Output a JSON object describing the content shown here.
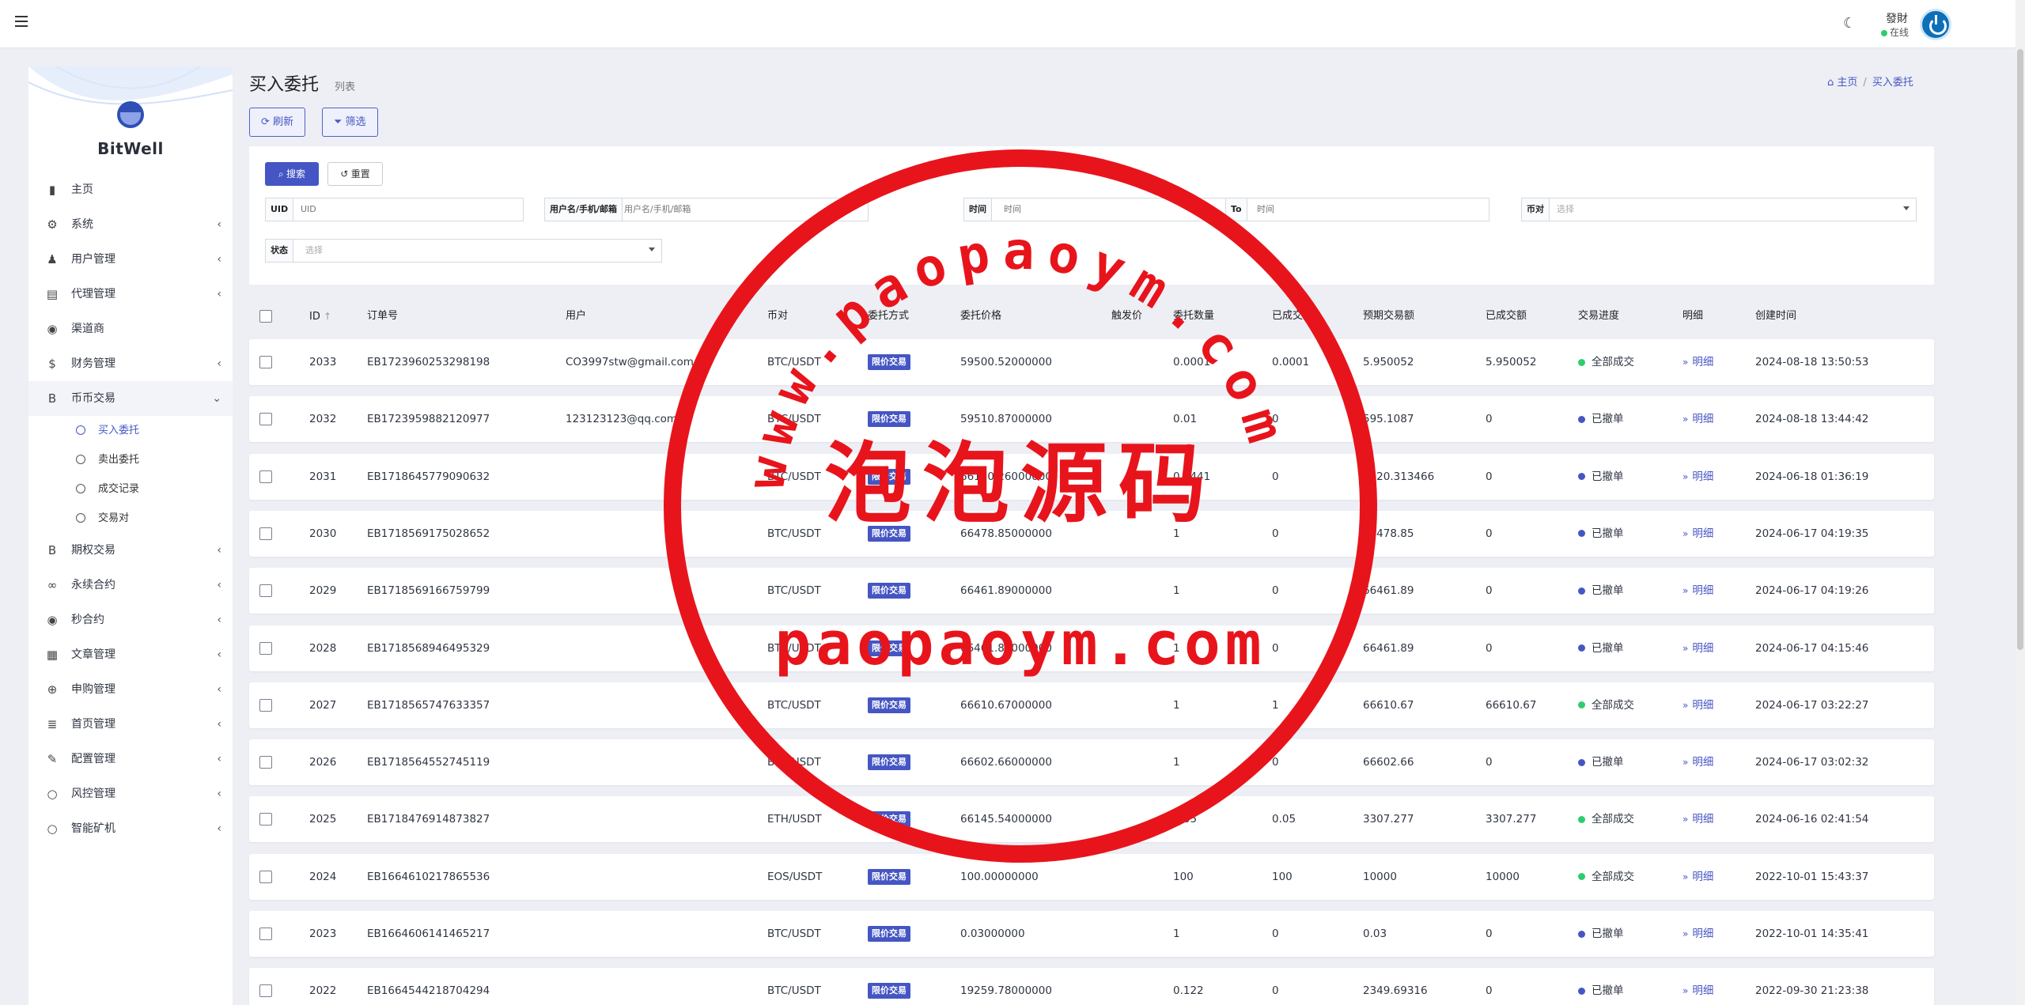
{
  "topbar": {
    "user_name": "發財",
    "user_status": "在线"
  },
  "sidebar": {
    "brand": "BitWell",
    "items": [
      {
        "label": "主页",
        "icon": "bar-chart-icon",
        "chev": false
      },
      {
        "label": "系统",
        "icon": "gear-icon",
        "chev": true
      },
      {
        "label": "用户管理",
        "icon": "users-icon",
        "chev": true
      },
      {
        "label": "代理管理",
        "icon": "id-card-icon",
        "chev": true
      },
      {
        "label": "渠道商",
        "icon": "user-circle-icon",
        "chev": false
      },
      {
        "label": "财务管理",
        "icon": "dollar-icon",
        "chev": true
      },
      {
        "label": "币币交易",
        "icon": "bitcoin-icon",
        "chev": true,
        "open": true
      }
    ],
    "sub_items": [
      {
        "label": "买入委托",
        "active": true
      },
      {
        "label": "卖出委托",
        "active": false
      },
      {
        "label": "成交记录",
        "active": false
      },
      {
        "label": "交易对",
        "active": false
      }
    ],
    "items_after": [
      {
        "label": "期权交易",
        "icon": "bitcoin-icon"
      },
      {
        "label": "永续合约",
        "icon": "link-icon"
      },
      {
        "label": "秒合约",
        "icon": "record-icon"
      },
      {
        "label": "文章管理",
        "icon": "newspaper-icon"
      },
      {
        "label": "申购管理",
        "icon": "life-ring-icon"
      },
      {
        "label": "首页管理",
        "icon": "list-icon"
      },
      {
        "label": "配置管理",
        "icon": "wrench-icon"
      },
      {
        "label": "风控管理",
        "icon": "circle-icon"
      },
      {
        "label": "智能矿机",
        "icon": "circle-icon"
      }
    ]
  },
  "page": {
    "title": "买入委托",
    "subtitle": "列表",
    "breadcrumb_home": "主页",
    "breadcrumb_current": "买入委托",
    "refresh_label": "刷新",
    "filter_label": "筛选"
  },
  "filters": {
    "search_label": "搜索",
    "reset_label": "重置",
    "uid_label": "UID",
    "uid_placeholder": "UID",
    "user_label": "用户名/手机/邮箱",
    "user_placeholder": "用户名/手机/邮箱",
    "time_label": "时间",
    "time_placeholder": "时间",
    "to_label": "To",
    "to_placeholder": "时间",
    "pair_label": "币对",
    "pair_placeholder": "选择",
    "status_label": "状态",
    "status_placeholder": "选择"
  },
  "table": {
    "headers": [
      "ID",
      "订单号",
      "用户",
      "币对",
      "委托方式",
      "委托价格",
      "触发价",
      "委托数量",
      "已成交数",
      "预期交易额",
      "已成交额",
      "交易进度",
      "明细",
      "创建时间"
    ],
    "sort_icon": "↑",
    "rows": [
      {
        "id": "2033",
        "order": "EB1723960253298198",
        "user": "CO3997stw@gmail.com",
        "pair": "BTC/USDT",
        "mode": "限价交易",
        "price": "59500.52000000",
        "trigger": "",
        "qty": "0.0001",
        "done_qty": "0.0001",
        "expected": "5.950052",
        "done_amt": "5.950052",
        "status": "全部成交",
        "status_color": "#2ecc71",
        "detail": "明细",
        "time": "2024-08-18 13:50:53"
      },
      {
        "id": "2032",
        "order": "EB1723959882120977",
        "user": "123123123@qq.com",
        "pair": "BTC/USDT",
        "mode": "限价交易",
        "price": "59510.87000000",
        "trigger": "",
        "qty": "0.01",
        "done_qty": "0",
        "expected": "595.1087",
        "done_amt": "0",
        "status": "已撤单",
        "status_color": "#4556c4",
        "detail": "明细",
        "time": "2024-08-18 13:44:42"
      },
      {
        "id": "2031",
        "order": "EB1718645779090632",
        "user": "",
        "pair": "BTC/USDT",
        "mode": "限价交易",
        "price": "66120.26000000",
        "trigger": "",
        "qty": "0.0441",
        "done_qty": "0",
        "expected": "2920.313466",
        "done_amt": "0",
        "status": "已撤单",
        "status_color": "#4556c4",
        "detail": "明细",
        "time": "2024-06-18 01:36:19"
      },
      {
        "id": "2030",
        "order": "EB1718569175028652",
        "user": "",
        "pair": "BTC/USDT",
        "mode": "限价交易",
        "price": "66478.85000000",
        "trigger": "",
        "qty": "1",
        "done_qty": "0",
        "expected": "66478.85",
        "done_amt": "0",
        "status": "已撤单",
        "status_color": "#4556c4",
        "detail": "明细",
        "time": "2024-06-17 04:19:35"
      },
      {
        "id": "2029",
        "order": "EB1718569166759799",
        "user": "",
        "pair": "BTC/USDT",
        "mode": "限价交易",
        "price": "66461.89000000",
        "trigger": "",
        "qty": "1",
        "done_qty": "0",
        "expected": "66461.89",
        "done_amt": "0",
        "status": "已撤单",
        "status_color": "#4556c4",
        "detail": "明细",
        "time": "2024-06-17 04:19:26"
      },
      {
        "id": "2028",
        "order": "EB1718568946495329",
        "user": "",
        "pair": "BTC/USDT",
        "mode": "限价交易",
        "price": "66461.89000000",
        "trigger": "",
        "qty": "1",
        "done_qty": "0",
        "expected": "66461.89",
        "done_amt": "0",
        "status": "已撤单",
        "status_color": "#4556c4",
        "detail": "明细",
        "time": "2024-06-17 04:15:46"
      },
      {
        "id": "2027",
        "order": "EB1718565747633357",
        "user": "",
        "pair": "BTC/USDT",
        "mode": "限价交易",
        "price": "66610.67000000",
        "trigger": "",
        "qty": "1",
        "done_qty": "1",
        "expected": "66610.67",
        "done_amt": "66610.67",
        "status": "全部成交",
        "status_color": "#2ecc71",
        "detail": "明细",
        "time": "2024-06-17 03:22:27"
      },
      {
        "id": "2026",
        "order": "EB1718564552745119",
        "user": "",
        "pair": "BTC/USDT",
        "mode": "限价交易",
        "price": "66602.66000000",
        "trigger": "",
        "qty": "1",
        "done_qty": "0",
        "expected": "66602.66",
        "done_amt": "0",
        "status": "已撤单",
        "status_color": "#4556c4",
        "detail": "明细",
        "time": "2024-06-17 03:02:32"
      },
      {
        "id": "2025",
        "order": "EB1718476914873827",
        "user": "",
        "pair": "ETH/USDT",
        "mode": "限价交易",
        "price": "66145.54000000",
        "trigger": "",
        "qty": "0.05",
        "done_qty": "0.05",
        "expected": "3307.277",
        "done_amt": "3307.277",
        "status": "全部成交",
        "status_color": "#2ecc71",
        "detail": "明细",
        "time": "2024-06-16 02:41:54"
      },
      {
        "id": "2024",
        "order": "EB1664610217865536",
        "user": "",
        "pair": "EOS/USDT",
        "mode": "限价交易",
        "price": "100.00000000",
        "trigger": "",
        "qty": "100",
        "done_qty": "100",
        "expected": "10000",
        "done_amt": "10000",
        "status": "全部成交",
        "status_color": "#2ecc71",
        "detail": "明细",
        "time": "2022-10-01 15:43:37"
      },
      {
        "id": "2023",
        "order": "EB1664606141465217",
        "user": "",
        "pair": "BTC/USDT",
        "mode": "限价交易",
        "price": "0.03000000",
        "trigger": "",
        "qty": "1",
        "done_qty": "0",
        "expected": "0.03",
        "done_amt": "0",
        "status": "已撤单",
        "status_color": "#4556c4",
        "detail": "明细",
        "time": "2022-10-01 14:35:41"
      },
      {
        "id": "2022",
        "order": "EB1664544218704294",
        "user": "",
        "pair": "BTC/USDT",
        "mode": "限价交易",
        "price": "19259.78000000",
        "trigger": "",
        "qty": "0.122",
        "done_qty": "0",
        "expected": "2349.69316",
        "done_amt": "0",
        "status": "已撤单",
        "status_color": "#4556c4",
        "detail": "明细",
        "time": "2022-09-30 21:23:38"
      }
    ]
  },
  "watermark": {
    "ring_text": "www.paopaoym.com",
    "center_text": "泡泡源码",
    "bottom_text": "paopaoym.com",
    "color": "#e8141c"
  }
}
